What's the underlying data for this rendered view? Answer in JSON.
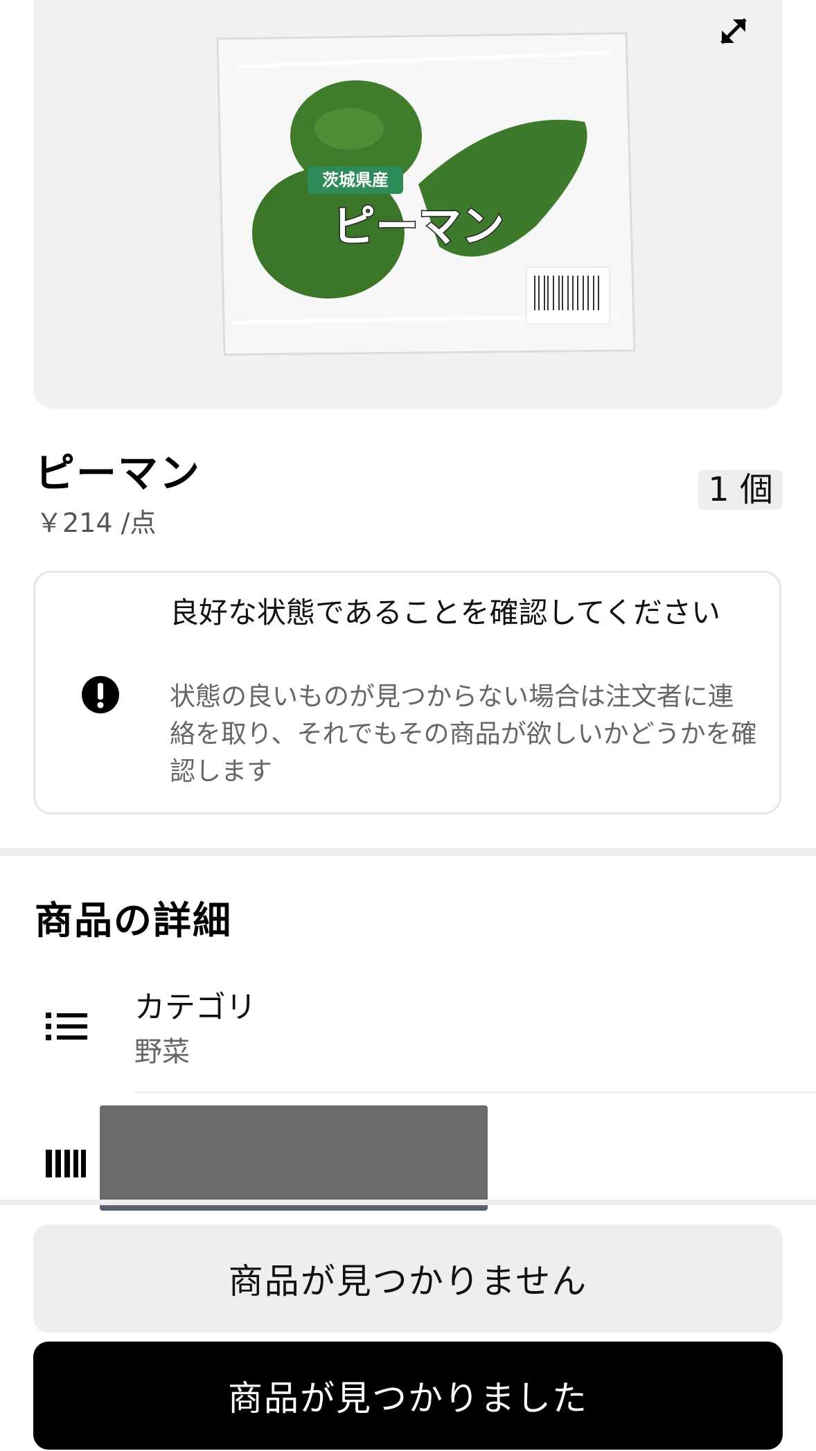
{
  "product": {
    "name": "ピーマン",
    "price": "￥214 /点",
    "quantity": "1 個",
    "image": {
      "origin_label": "茨城県産",
      "package_label": "ピーマン"
    }
  },
  "notice": {
    "title": "良好な状態であることを確認してください",
    "body": "状態の良いものが見つからない場合は注文者に連絡を取り、それでもその商品が欲しいかどうかを確認します"
  },
  "details": {
    "section_title": "商品の詳細",
    "category_label": "カテゴリ",
    "category_value": "野菜"
  },
  "actions": {
    "not_found": "商品が見つかりません",
    "found": "商品が見つかりました"
  }
}
